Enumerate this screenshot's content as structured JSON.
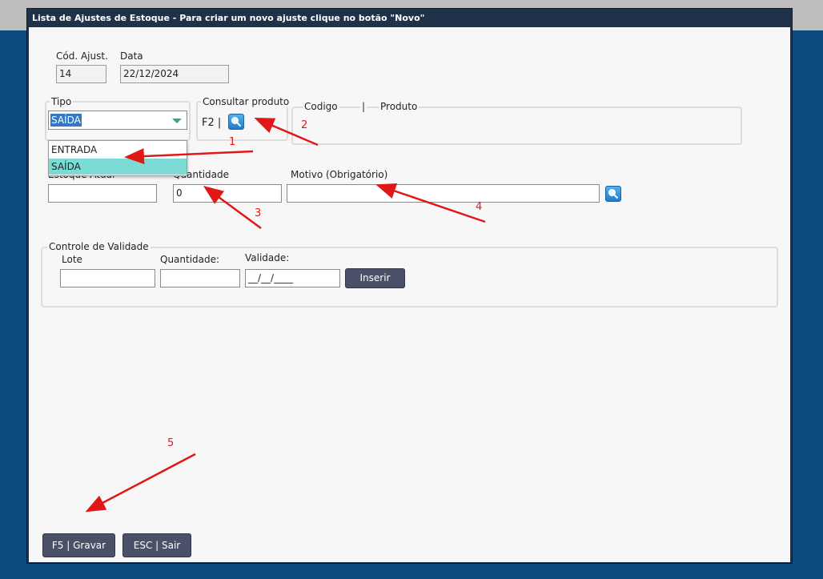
{
  "window": {
    "title": "Lista de Ajustes de Estoque - Para criar um novo ajuste clique no botão \"Novo\""
  },
  "header_fields": {
    "cod_label": "Cód. Ajust.",
    "cod_value": "14",
    "data_label": "Data",
    "data_value": "22/12/2024"
  },
  "tipo": {
    "legend": "Tipo",
    "selected": "SAÍDA",
    "options": [
      "ENTRADA",
      "SAÍDA"
    ]
  },
  "consultar": {
    "legend": "Consultar produto",
    "shortcut": "F2 |",
    "search_icon": "search-icon"
  },
  "produto": {
    "codigo_label": "Codigo",
    "separator": "|",
    "produto_label": "Produto"
  },
  "estoque": {
    "estoque_label": "Estoque Atual",
    "estoque_value": "",
    "quantidade_label": "Quantidade",
    "quantidade_value": "0",
    "motivo_label": "Motivo (Obrigatório)",
    "motivo_value": "",
    "motivo_search_icon": "search-icon"
  },
  "validade": {
    "legend": "Controle de Validade",
    "lote_label": "Lote",
    "lote_value": "",
    "quantidade_label": "Quantidade:",
    "quantidade_value": "",
    "validade_label": "Validade:",
    "validade_mask": "__/__/____",
    "inserir_button": "Inserir"
  },
  "footer": {
    "gravar_button": "F5 | Gravar",
    "sair_button": "ESC | Sair"
  },
  "annotations": [
    "1",
    "2",
    "3",
    "4",
    "5"
  ],
  "colors": {
    "background": "#0d4a7f",
    "titlebar": "#20324a",
    "panel": "#f7f7f7",
    "button": "#4a5068",
    "select_highlight": "#3478c4",
    "dropdown_selected": "#7ddbd5",
    "annotation": "#e01818"
  }
}
